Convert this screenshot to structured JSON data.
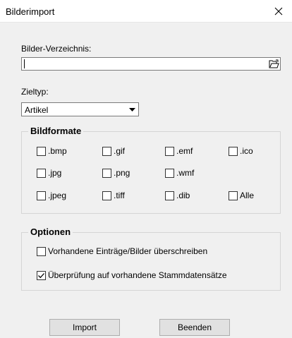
{
  "window": {
    "title": "Bilderimport"
  },
  "directory": {
    "label": "Bilder-Verzeichnis:",
    "value": ""
  },
  "target_type": {
    "label": "Zieltyp:",
    "selected": "Artikel"
  },
  "formats": {
    "title": "Bildformate",
    "items": [
      {
        "label": ".bmp",
        "checked": false
      },
      {
        "label": ".gif",
        "checked": false
      },
      {
        "label": ".emf",
        "checked": false
      },
      {
        "label": ".ico",
        "checked": false
      },
      {
        "label": ".jpg",
        "checked": false
      },
      {
        "label": ".png",
        "checked": false
      },
      {
        "label": ".wmf",
        "checked": false
      },
      {
        "label": ".jpeg",
        "checked": false
      },
      {
        "label": ".tiff",
        "checked": false
      },
      {
        "label": ".dib",
        "checked": false
      },
      {
        "label": "Alle",
        "checked": false
      }
    ]
  },
  "options": {
    "title": "Optionen",
    "items": [
      {
        "label": "Vorhandene Einträge/Bilder überschreiben",
        "checked": false
      },
      {
        "label": "Überprüfung auf vorhandene Stammdatensätze",
        "checked": true
      }
    ]
  },
  "buttons": {
    "import": "Import",
    "close": "Beenden"
  },
  "icons": {
    "close": "close-icon",
    "browse": "folder-open-icon",
    "dropdown": "dropdown-arrow-icon",
    "check": "checkmark-icon"
  }
}
